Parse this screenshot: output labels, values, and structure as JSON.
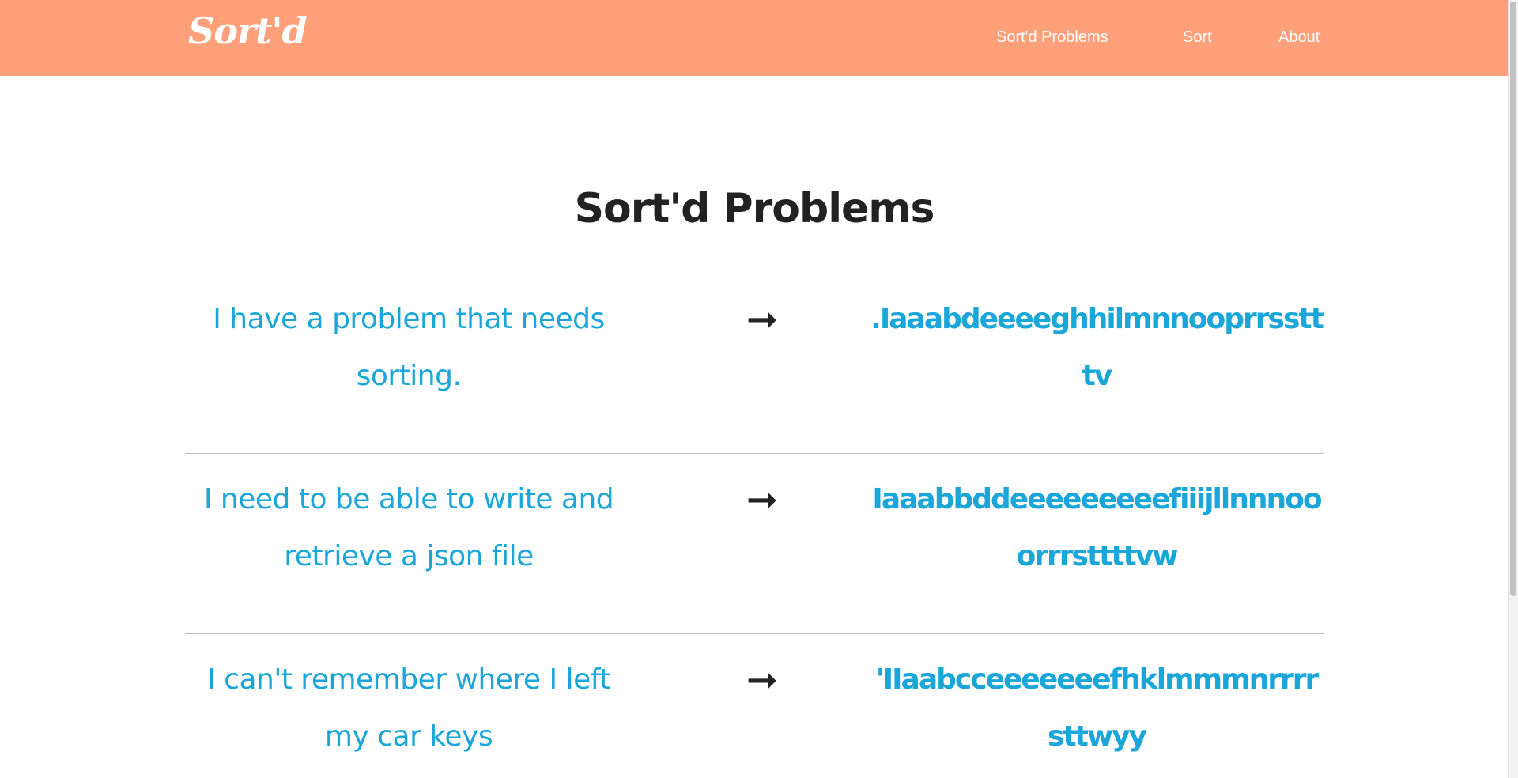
{
  "brand": "Sort'd",
  "nav": {
    "problems": "Sort'd Problems",
    "sort": "Sort",
    "about": "About"
  },
  "page_title": "Sort'd Problems",
  "arrow": "➞",
  "problems": [
    {
      "original": "I have a problem that needs sorting.",
      "sorted": ".Iaaabdeeeeghhilmnnooprrsstttv"
    },
    {
      "original": "I need to be able to write and retrieve a json file",
      "sorted": "Iaaabbddeeeeeeeeefiiijllnnnooorrrsttttvw"
    },
    {
      "original": "I can't remember where I left my car keys",
      "sorted": "'IIaabcceeeeeeefhklmmmnrrrrsttwyy"
    }
  ],
  "colors": {
    "navbar": "#ffa07a",
    "accent": "#1ba6d9",
    "title": "#222222"
  }
}
